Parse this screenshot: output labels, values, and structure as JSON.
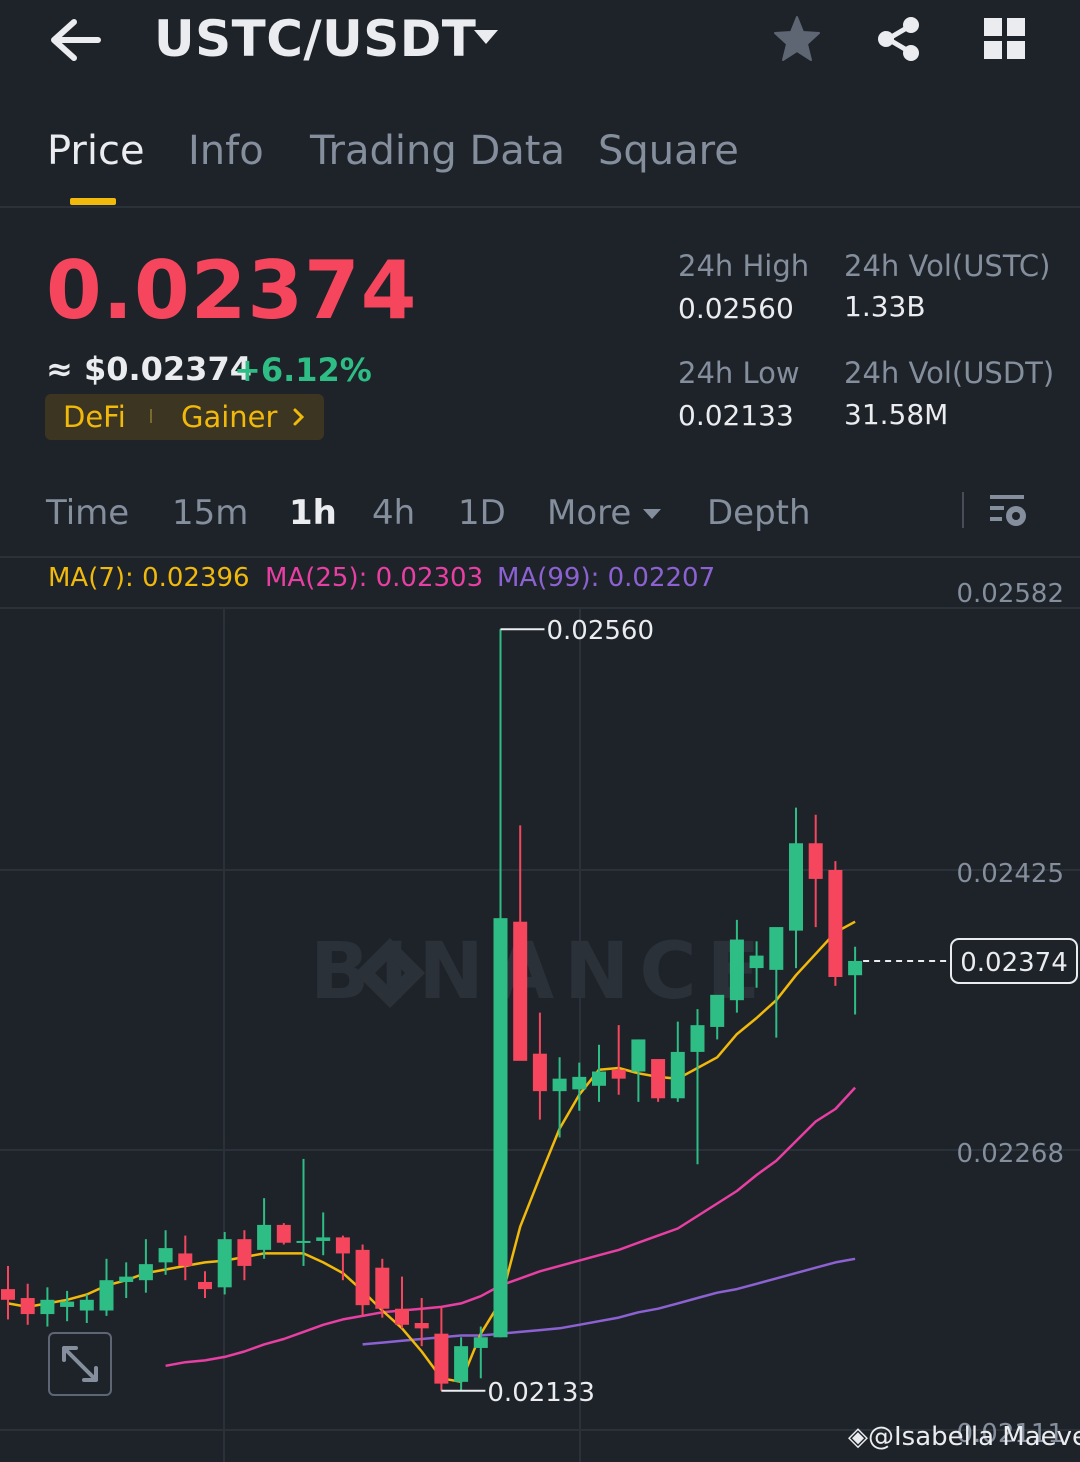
{
  "header": {
    "pair": "USTC/USDT",
    "icons": [
      "back-arrow-icon",
      "caret-down-icon",
      "star-icon",
      "share-icon",
      "grid-icon"
    ]
  },
  "tabs": [
    {
      "label": "Price",
      "active": true
    },
    {
      "label": "Info",
      "active": false
    },
    {
      "label": "Trading Data",
      "active": false
    },
    {
      "label": "Square",
      "active": false
    }
  ],
  "ticker": {
    "last_price": "0.02374",
    "usd_price": "≈ $0.02374",
    "change_pct": "+6.12%",
    "tags": [
      "DeFi",
      "Gainer"
    ],
    "high_label": "24h High",
    "high_value": "0.02560",
    "low_label": "24h Low",
    "low_value": "0.02133",
    "vol_base_label": "24h Vol(USTC)",
    "vol_base_value": "1.33B",
    "vol_quote_label": "24h Vol(USDT)",
    "vol_quote_value": "31.58M"
  },
  "intervals": {
    "items": [
      "Time",
      "15m",
      "1h",
      "4h",
      "1D",
      "More",
      "Depth"
    ],
    "active": "1h"
  },
  "ma_legend": {
    "ma7": "MA(7): 0.02396",
    "ma25": "MA(25): 0.02303",
    "ma99": "MA(99): 0.02207"
  },
  "colors": {
    "up": "#2ebd85",
    "down": "#f6465d",
    "accent": "#f0b90b",
    "ma7": "#f0b90b",
    "ma25": "#e83fa3",
    "ma99": "#8c62d3",
    "background": "#1e2329"
  },
  "chart_data": {
    "type": "candlestick",
    "interval": "1h",
    "y_ticks": [
      "0.02582",
      "0.02425",
      "0.02268",
      "0.02111"
    ],
    "ylim": [
      0.02105,
      0.02585
    ],
    "annotations": {
      "high": "0.02560",
      "low": "0.02133",
      "current_price_label": "0.02374"
    },
    "watermark": "BINANCE",
    "candles": [
      {
        "o": 0.0219,
        "h": 0.02203,
        "l": 0.02173,
        "c": 0.02184
      },
      {
        "o": 0.02185,
        "h": 0.02193,
        "l": 0.0217,
        "c": 0.02176
      },
      {
        "o": 0.02176,
        "h": 0.02191,
        "l": 0.02169,
        "c": 0.02184
      },
      {
        "o": 0.0218,
        "h": 0.02189,
        "l": 0.02172,
        "c": 0.02183
      },
      {
        "o": 0.02178,
        "h": 0.02187,
        "l": 0.02171,
        "c": 0.02184
      },
      {
        "o": 0.02178,
        "h": 0.02207,
        "l": 0.02175,
        "c": 0.02195
      },
      {
        "o": 0.02194,
        "h": 0.02205,
        "l": 0.02185,
        "c": 0.02197
      },
      {
        "o": 0.02195,
        "h": 0.02218,
        "l": 0.02188,
        "c": 0.02204
      },
      {
        "o": 0.02205,
        "h": 0.02223,
        "l": 0.02198,
        "c": 0.02213
      },
      {
        "o": 0.0221,
        "h": 0.0222,
        "l": 0.02195,
        "c": 0.02203
      },
      {
        "o": 0.02194,
        "h": 0.022,
        "l": 0.02185,
        "c": 0.0219
      },
      {
        "o": 0.02191,
        "h": 0.02222,
        "l": 0.02187,
        "c": 0.02218
      },
      {
        "o": 0.02218,
        "h": 0.02223,
        "l": 0.02195,
        "c": 0.02203
      },
      {
        "o": 0.02212,
        "h": 0.02241,
        "l": 0.02207,
        "c": 0.02226
      },
      {
        "o": 0.02226,
        "h": 0.02227,
        "l": 0.02215,
        "c": 0.02216
      },
      {
        "o": 0.02216,
        "h": 0.02263,
        "l": 0.02203,
        "c": 0.02217
      },
      {
        "o": 0.02217,
        "h": 0.02233,
        "l": 0.02209,
        "c": 0.02219
      },
      {
        "o": 0.02219,
        "h": 0.0222,
        "l": 0.02195,
        "c": 0.0221
      },
      {
        "o": 0.02212,
        "h": 0.02215,
        "l": 0.02175,
        "c": 0.02181
      },
      {
        "o": 0.02202,
        "h": 0.02207,
        "l": 0.02174,
        "c": 0.02179
      },
      {
        "o": 0.02179,
        "h": 0.02197,
        "l": 0.02168,
        "c": 0.0217
      },
      {
        "o": 0.02171,
        "h": 0.02185,
        "l": 0.02158,
        "c": 0.02168
      },
      {
        "o": 0.02165,
        "h": 0.0218,
        "l": 0.02133,
        "c": 0.02137
      },
      {
        "o": 0.02138,
        "h": 0.02163,
        "l": 0.02133,
        "c": 0.02158
      },
      {
        "o": 0.02157,
        "h": 0.02169,
        "l": 0.0214,
        "c": 0.02163
      },
      {
        "o": 0.02163,
        "h": 0.0256,
        "l": 0.02163,
        "c": 0.02398
      },
      {
        "o": 0.02396,
        "h": 0.0245,
        "l": 0.02323,
        "c": 0.02318
      },
      {
        "o": 0.02322,
        "h": 0.02345,
        "l": 0.02285,
        "c": 0.02301
      },
      {
        "o": 0.02301,
        "h": 0.0232,
        "l": 0.02275,
        "c": 0.02308
      },
      {
        "o": 0.02302,
        "h": 0.02317,
        "l": 0.0229,
        "c": 0.02309
      },
      {
        "o": 0.02304,
        "h": 0.02327,
        "l": 0.02295,
        "c": 0.02312
      },
      {
        "o": 0.02313,
        "h": 0.02338,
        "l": 0.02299,
        "c": 0.02308
      },
      {
        "o": 0.02312,
        "h": 0.0233,
        "l": 0.02295,
        "c": 0.0233
      },
      {
        "o": 0.02319,
        "h": 0.02317,
        "l": 0.02295,
        "c": 0.02297
      },
      {
        "o": 0.02297,
        "h": 0.0234,
        "l": 0.02295,
        "c": 0.02323
      },
      {
        "o": 0.02323,
        "h": 0.02347,
        "l": 0.0226,
        "c": 0.02338
      },
      {
        "o": 0.02337,
        "h": 0.02351,
        "l": 0.0233,
        "c": 0.02355
      },
      {
        "o": 0.02352,
        "h": 0.02397,
        "l": 0.02345,
        "c": 0.02386
      },
      {
        "o": 0.0237,
        "h": 0.02385,
        "l": 0.02359,
        "c": 0.02377
      },
      {
        "o": 0.02369,
        "h": 0.02387,
        "l": 0.02331,
        "c": 0.02393
      },
      {
        "o": 0.02391,
        "h": 0.0246,
        "l": 0.0237,
        "c": 0.0244
      },
      {
        "o": 0.0244,
        "h": 0.02456,
        "l": 0.02393,
        "c": 0.0242
      },
      {
        "o": 0.02425,
        "h": 0.0243,
        "l": 0.0236,
        "c": 0.02365
      },
      {
        "o": 0.02366,
        "h": 0.02382,
        "l": 0.02344,
        "c": 0.02374
      }
    ],
    "ma7": [
      0.02182,
      0.0218,
      0.02182,
      0.02184,
      0.02187,
      0.02192,
      0.02195,
      0.02199,
      0.02201,
      0.02203,
      0.02205,
      0.02206,
      0.02208,
      0.0221,
      0.0221,
      0.0221,
      0.02205,
      0.02199,
      0.02189,
      0.02178,
      0.02168,
      0.02155,
      0.0214,
      0.02138,
      0.02165,
      0.02183,
      0.02225,
      0.02253,
      0.0228,
      0.02299,
      0.02313,
      0.02314,
      0.02311,
      0.02309,
      0.02308,
      0.02314,
      0.0232,
      0.02333,
      0.02342,
      0.02352,
      0.02366,
      0.02378,
      0.0239,
      0.02396
    ],
    "ma25": [
      0.02147,
      0.02149,
      0.0215,
      0.02152,
      0.02155,
      0.02159,
      0.02162,
      0.02166,
      0.0217,
      0.02173,
      0.02175,
      0.02177,
      0.02178,
      0.02179,
      0.0218,
      0.02182,
      0.02186,
      0.02192,
      0.02196,
      0.022,
      0.02203,
      0.02206,
      0.02209,
      0.02212,
      0.02216,
      0.0222,
      0.02224,
      0.02231,
      0.02238,
      0.02245,
      0.02254,
      0.02262,
      0.02273,
      0.02284,
      0.02291,
      0.02303
    ],
    "ma99": [
      0.02159,
      0.0216,
      0.02161,
      0.02162,
      0.02163,
      0.02164,
      0.02164,
      0.02165,
      0.02166,
      0.02167,
      0.02168,
      0.0217,
      0.02172,
      0.02174,
      0.02177,
      0.02179,
      0.02182,
      0.02185,
      0.02188,
      0.0219,
      0.02193,
      0.02196,
      0.02199,
      0.02202,
      0.02205,
      0.02207
    ]
  },
  "footer": {
    "credit": "@Isabella Maeve"
  }
}
